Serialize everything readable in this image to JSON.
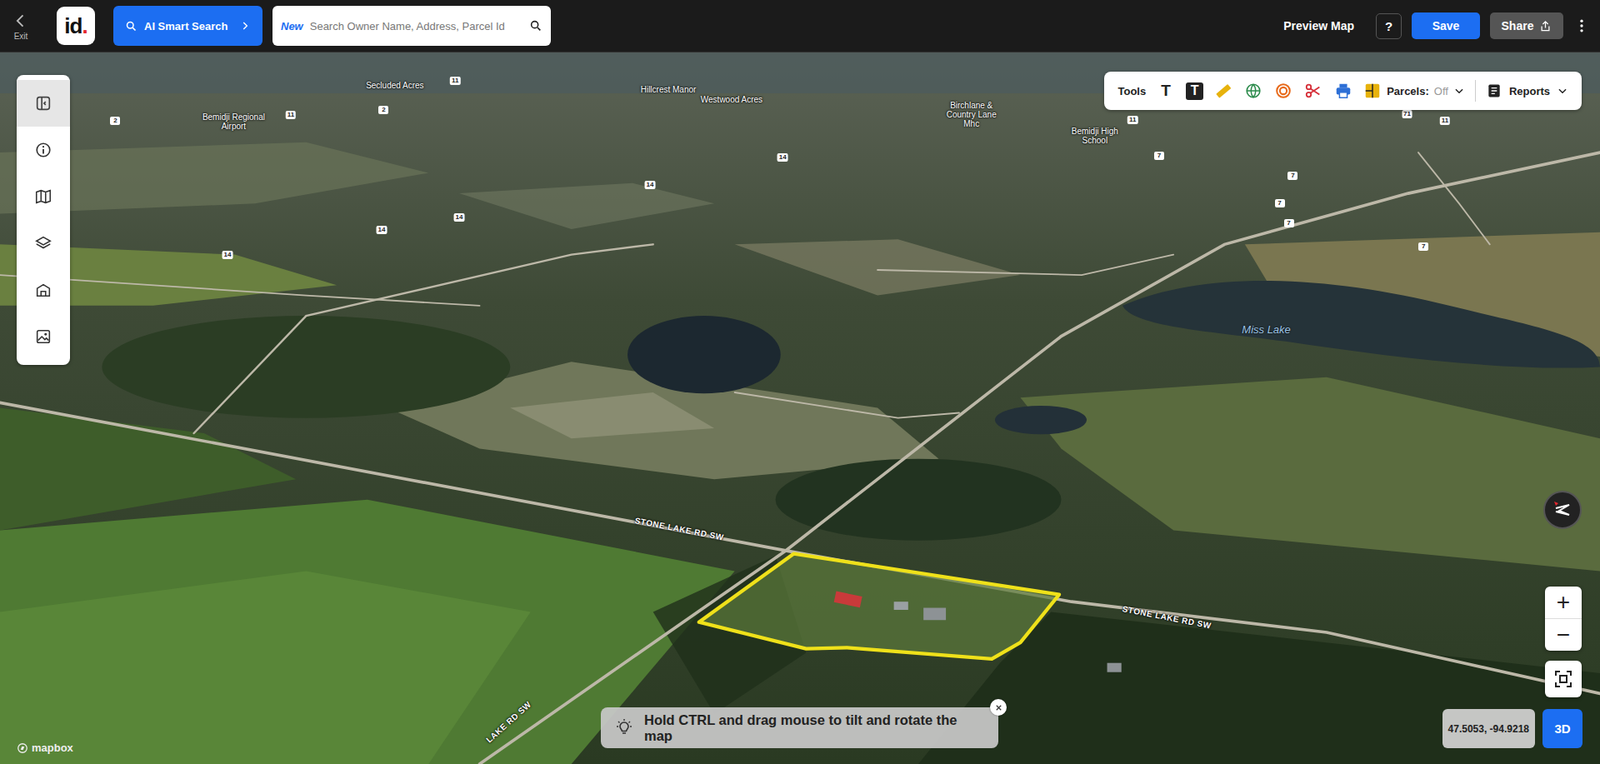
{
  "topbar": {
    "exit_label": "Exit",
    "logo": {
      "text": "id",
      "dot": "."
    },
    "ai_search": "AI Smart Search",
    "search": {
      "badge": "New",
      "placeholder": "Search Owner Name, Address, Parcel Id"
    },
    "preview": "Preview Map",
    "help": "?",
    "save": "Save",
    "share": "Share"
  },
  "side_panel": {
    "items": [
      {
        "selected": true
      },
      {
        "selected": false
      },
      {
        "selected": false
      },
      {
        "selected": false
      },
      {
        "selected": false
      },
      {
        "selected": false
      }
    ]
  },
  "tools": {
    "label": "Tools",
    "text_tools": [
      "T",
      "T"
    ],
    "parcels": {
      "label": "Parcels:",
      "state": "Off"
    },
    "reports": "Reports"
  },
  "map": {
    "places": [
      "Bemidji Regional Airport",
      "Secluded Acres",
      "Hillcrest Manor",
      "Westwood Acres",
      "Birchlane & Country Lane Mhc",
      "Bemidji High School"
    ],
    "water": [
      "Miss Lake"
    ],
    "roads": [
      "STONE LAKE RD SW",
      "STONE LAKE RD SW",
      "LAKE RD SW"
    ],
    "shields": [
      "2",
      "11",
      "2",
      "11",
      "14",
      "14",
      "14",
      "14",
      "14",
      "11",
      "7",
      "7",
      "7",
      "7",
      "7",
      "71",
      "11"
    ]
  },
  "tip": {
    "text": "Hold CTRL and drag mouse to tilt and rotate the map"
  },
  "zoom": {
    "in": "+",
    "out": "−"
  },
  "coordinates": "47.5053, -94.9218",
  "view_mode": {
    "label": "3D",
    "selected": true
  },
  "attribution": "mapbox"
}
